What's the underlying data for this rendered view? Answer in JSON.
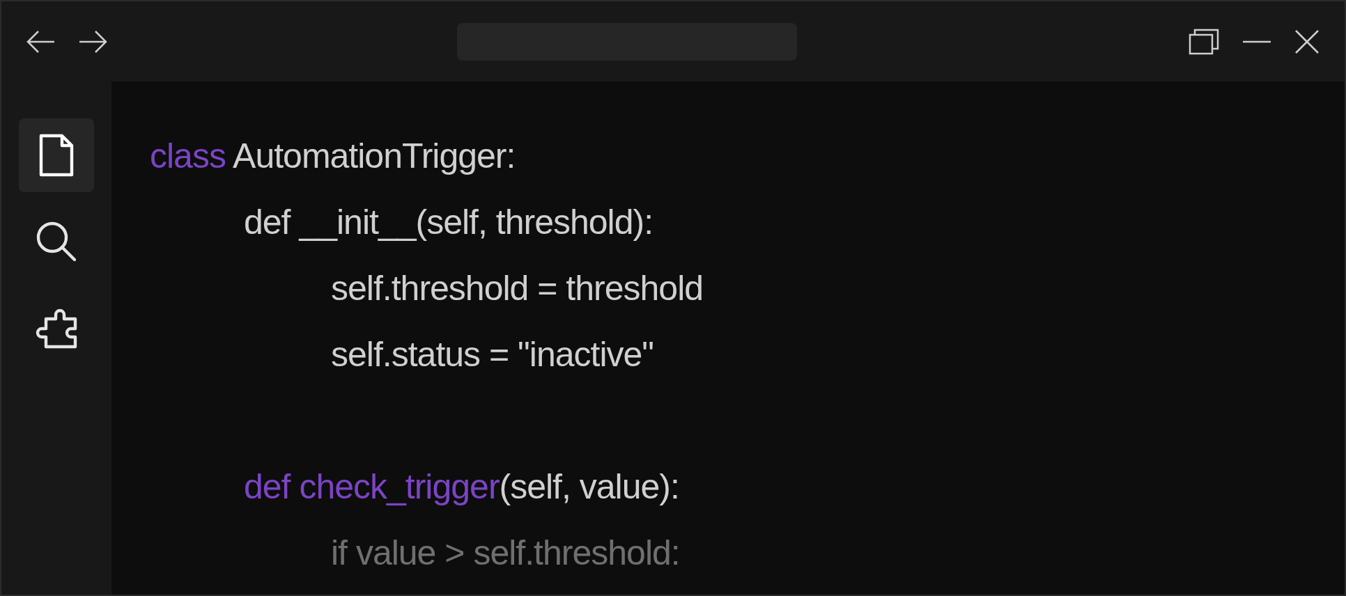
{
  "sidebar": {
    "items": [
      {
        "kind": "file",
        "selected": true
      },
      {
        "kind": "search",
        "selected": false
      },
      {
        "kind": "extensions",
        "selected": false
      }
    ]
  },
  "code": {
    "lines": [
      {
        "segments": [
          {
            "highlight": true,
            "text": "class"
          },
          {
            "highlight": false,
            "text": " AutomationTrigger:"
          }
        ],
        "children": [
          {
            "segments": [
              {
                "highlight": false,
                "text": "def __init__(self, threshold):"
              }
            ],
            "children": [
              {
                "segments": [
                  {
                    "highlight": false,
                    "text": "self.threshold = threshold"
                  }
                ]
              },
              {
                "segments": [
                  {
                    "highlight": false,
                    "text": "self.status = \"inactive\""
                  }
                ]
              }
            ]
          },
          {
            "kind": "blank"
          },
          {
            "segments": [
              {
                "highlight": true,
                "text": "def check_trigger"
              },
              {
                "highlight": false,
                "text": "(self, value):"
              }
            ],
            "children": [
              {
                "segments": [
                  {
                    "highlight": false,
                    "text": "if value > self.threshold:"
                  }
                ],
                "dimmed": true
              }
            ]
          }
        ]
      }
    ]
  }
}
